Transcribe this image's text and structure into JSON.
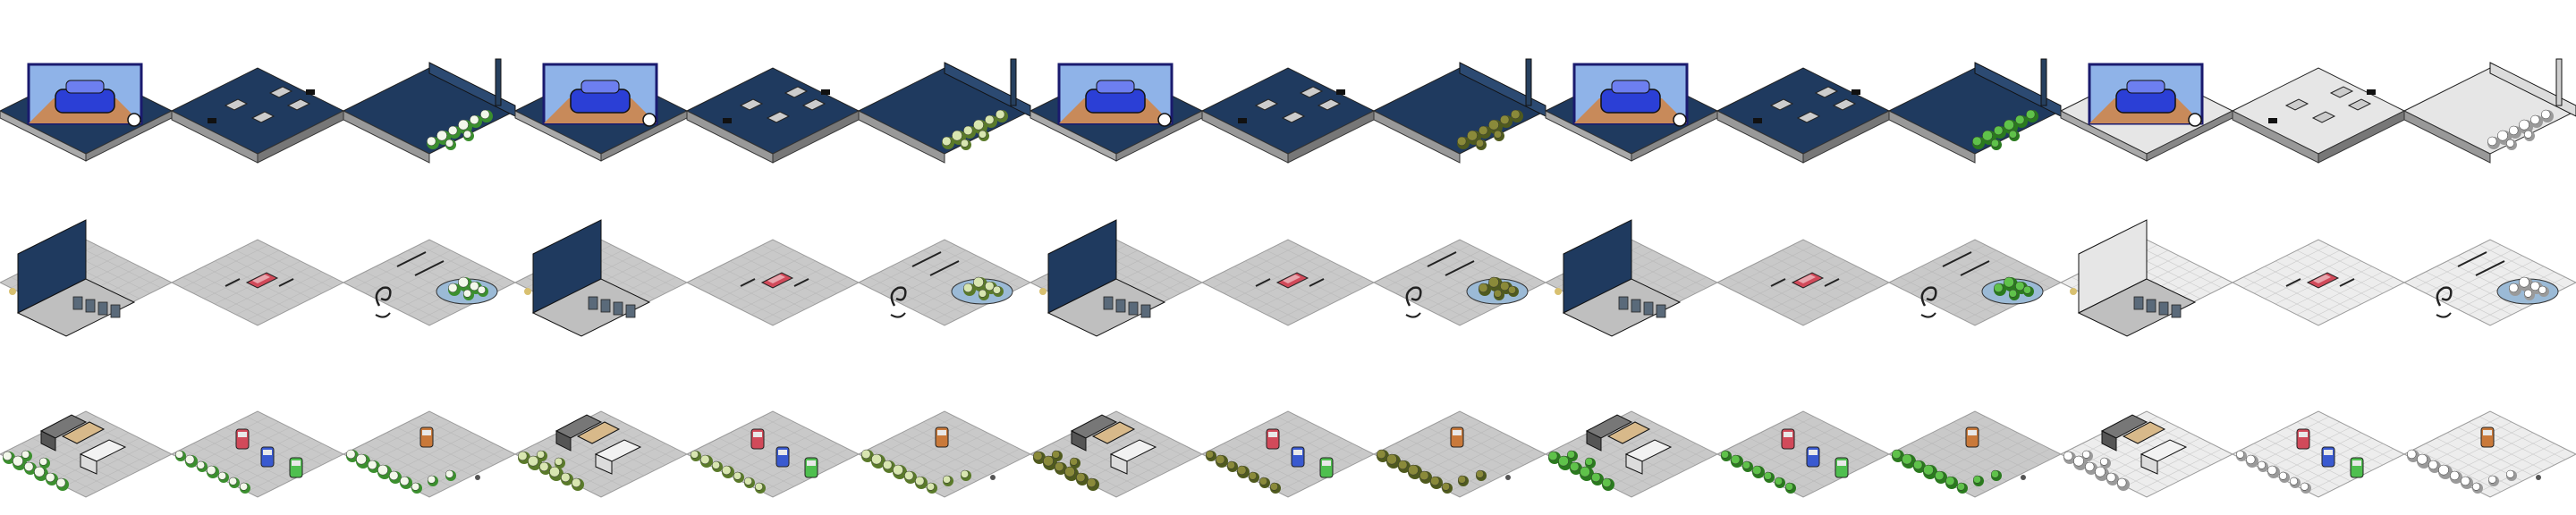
{
  "sprite_sheet": {
    "columns": 15,
    "rows": 3,
    "season_palettes": [
      {
        "name": "summer",
        "foliage": "#f2f8ea",
        "foliage_dark": "#3b8f2e",
        "roof": "#1f3a5f",
        "ground": "#c9c9c9"
      },
      {
        "name": "spring",
        "foliage": "#d8e6b0",
        "foliage_dark": "#5a7a2a",
        "roof": "#1f3a5f",
        "ground": "#c9c9c9"
      },
      {
        "name": "autumn",
        "foliage": "#8a8a3a",
        "foliage_dark": "#4f5a1e",
        "roof": "#1f3a5f",
        "ground": "#c9c9c9"
      },
      {
        "name": "green",
        "foliage": "#5fc24a",
        "foliage_dark": "#2a7a1e",
        "roof": "#1f3a5f",
        "ground": "#c9c9c9"
      },
      {
        "name": "winter",
        "foliage": "#ffffff",
        "foliage_dark": "#9a9a9a",
        "roof": "#e6e6e6",
        "ground": "#ededed"
      }
    ],
    "tiles": [
      [
        "billboard-roof",
        "parking-roof",
        "building-roof-hedge"
      ],
      [
        "building-front",
        "parking-red-car",
        "parking-fountain-hedge"
      ],
      [
        "parking-vehicles-hedge",
        "parking-three-cars",
        "parking-orange-car-hedge"
      ]
    ],
    "billboard_colors": {
      "car": "#2b3fd6",
      "sky": "#8fb3e8",
      "frame": "#1a1a6e",
      "hill": "#c88a5a"
    },
    "car_colors": {
      "red": "#d14a5a",
      "blue": "#3a5ad0",
      "green": "#4fbf4f",
      "orange": "#c9793a"
    }
  }
}
